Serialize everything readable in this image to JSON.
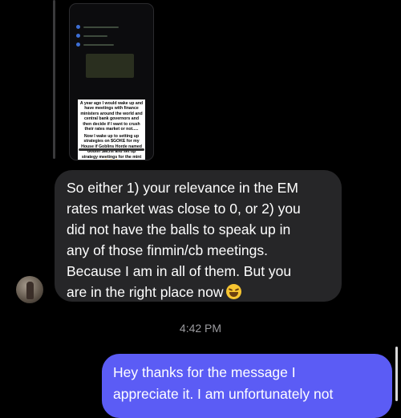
{
  "shared_story": {
    "caption_1": "A year ago I would wake up and have meetings with finance ministers around the world and central bank governors and then decide if I want to crush their rates market or not.....",
    "caption_2": "Now I wake up to setting up strategies on $GOKE for my House if Goblins Horde named Goblin Sachs and set up strategy meetings for the mint 😂😂😂"
  },
  "messages": {
    "incoming": {
      "lines": [
        "So either 1) your relevance in the EM",
        "rates market was close to 0, or 2) you",
        "did not have the balls to speak up in",
        "any of those finmin/cb meetings.",
        "Because I am in all of them. But you",
        "are in the right place now"
      ],
      "emoji": "laughing-emoji"
    },
    "timestamp": "4:42 PM",
    "outgoing": {
      "lines": [
        "Hey thanks for the message I",
        "appreciate it. I am unfortunately not"
      ]
    }
  },
  "colors": {
    "background": "#000000",
    "incoming_bubble": "#262628",
    "outgoing_bubble": "#5b5cf5",
    "timestamp": "#9b9b9f"
  }
}
